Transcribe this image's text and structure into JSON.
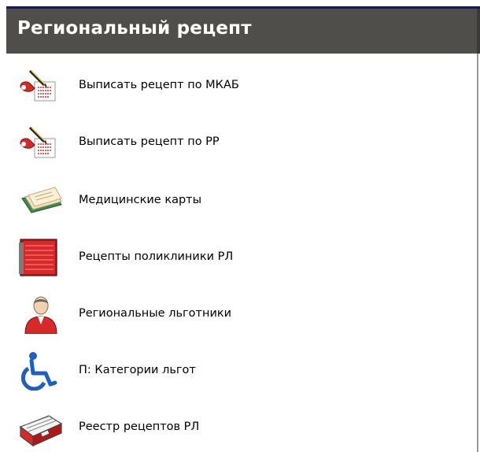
{
  "panel": {
    "title": "Региональный рецепт"
  },
  "menu": {
    "items": [
      {
        "label": "Выписать рецепт по МКАБ",
        "icon": "prescription-pen-icon"
      },
      {
        "label": "Выписать рецепт по РР",
        "icon": "prescription-pen-icon"
      },
      {
        "label": "Медицинские карты",
        "icon": "medical-cards-icon"
      },
      {
        "label": "Рецепты поликлиники РЛ",
        "icon": "red-folder-icon"
      },
      {
        "label": "Региональные льготники",
        "icon": "person-icon"
      },
      {
        "label": "П: Категории льгот",
        "icon": "wheelchair-icon"
      },
      {
        "label": "Реестр рецептов РЛ",
        "icon": "card-index-icon"
      }
    ]
  },
  "colors": {
    "header_bg": "#4f4e4b",
    "header_text": "#ffffff",
    "top_border": "#17194f",
    "accent_red": "#d62a2a",
    "accent_blue": "#1f5fc2"
  }
}
